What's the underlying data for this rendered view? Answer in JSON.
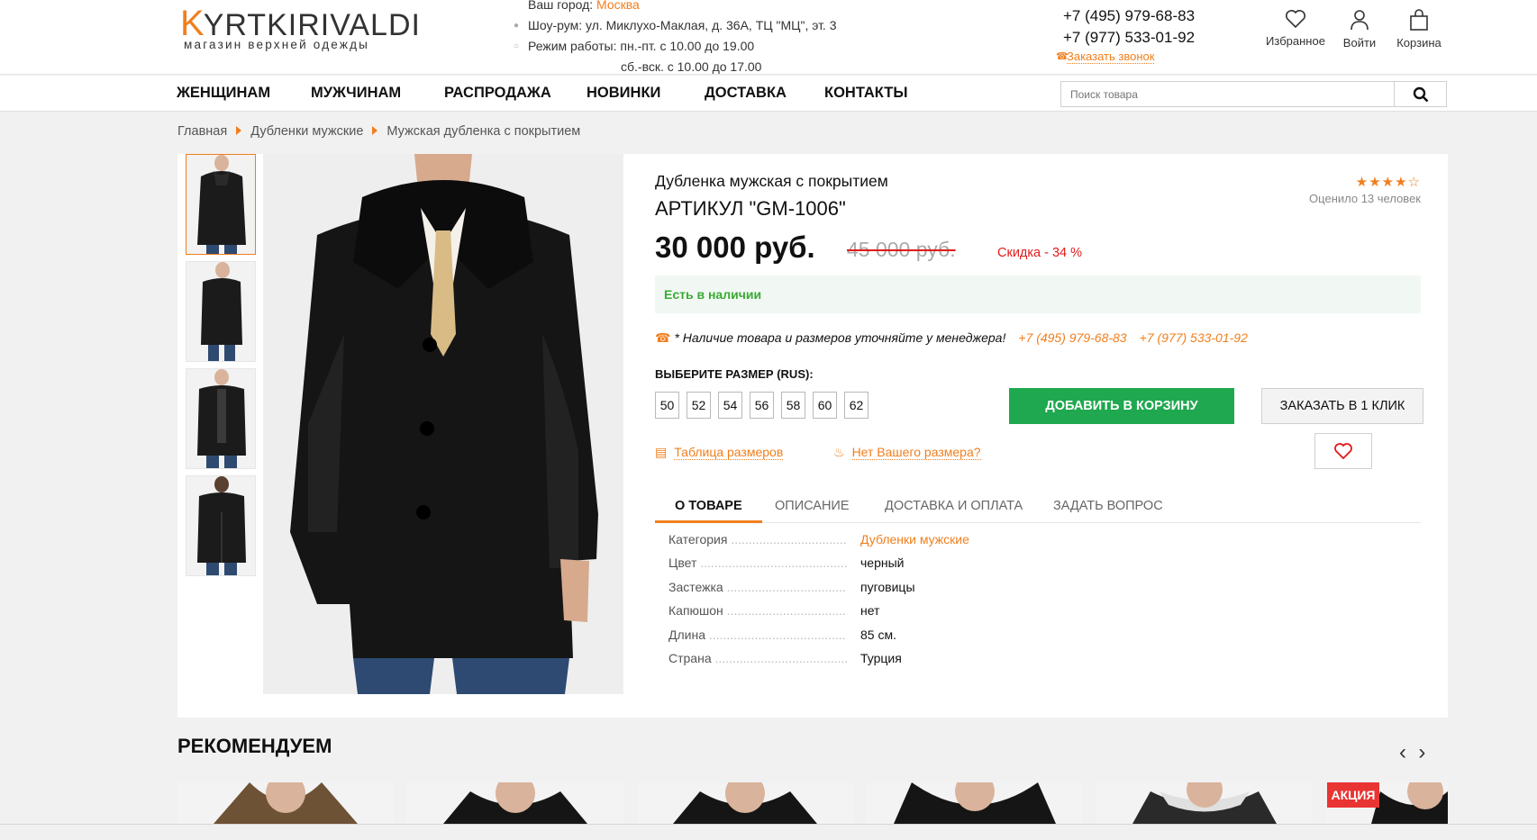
{
  "logo": {
    "main_a": "KYRTKI",
    "main_b": "RIVALDI",
    "sub": "магазин верхней одежды"
  },
  "header": {
    "city_label": "Ваш город:",
    "city": "Москва",
    "showroom": "Шоу-рум: ул. Миклухо-Маклая, д. 36А, ТЦ \"МЦ\", эт. 3",
    "hours_1": "Режим работы: пн.-пт.  с 10.00 до 19.00",
    "hours_2": "сб.-вск. с 10.00 до 17.00",
    "phone_1": "+7 (495) 979-68-83",
    "phone_2": "+7 (977) 533-01-92",
    "callback": "Заказать звонок",
    "favorites": "Избранное",
    "login": "Войти",
    "cart": "Корзина"
  },
  "nav": {
    "items": [
      "ЖЕНЩИНАМ",
      "МУЖЧИНАМ",
      "РАСПРОДАЖА",
      "НОВИНКИ",
      "ДОСТАВКА",
      "КОНТАКТЫ"
    ],
    "search_placeholder": "Поиск товара"
  },
  "breadcrumb": [
    "Главная",
    "Дубленки мужские",
    "Мужская дубленка с покрытием"
  ],
  "product": {
    "subtitle": "Дубленка мужская с покрытием",
    "title": "АРТИКУЛ \"GM-1006\"",
    "price": "30 000 руб.",
    "old_price": "45 000 руб.",
    "discount": "Скидка - 34 %",
    "rating_stars": 4,
    "rating_text": "Оценило 13 человек",
    "stock": "Есть в наличии",
    "note": "* Наличие товара и размеров уточняйте у менеджера!",
    "note_phone_1": "+7 (495) 979-68-83",
    "note_phone_2": "+7 (977) 533-01-92",
    "size_label": "ВЫБЕРИТЕ РАЗМЕР (RUS):",
    "sizes": [
      "50",
      "52",
      "54",
      "56",
      "58",
      "60",
      "62"
    ],
    "add_to_cart": "ДОБАВИТЬ В КОРЗИНУ",
    "one_click": "ЗАКАЗАТЬ В 1 КЛИК",
    "size_table": "Таблица размеров",
    "no_size": "Нет Вашего размера?"
  },
  "tabs": [
    "О ТОВАРЕ",
    "ОПИСАНИЕ",
    "ДОСТАВКА И ОПЛАТА",
    "ЗАДАТЬ ВОПРОС"
  ],
  "props": [
    {
      "k": "Категория",
      "v": "Дубленки мужские"
    },
    {
      "k": "Цвет",
      "v": "черный"
    },
    {
      "k": "Застежка",
      "v": "пуговицы"
    },
    {
      "k": "Капюшон",
      "v": "нет"
    },
    {
      "k": "Длина",
      "v": "85 см."
    },
    {
      "k": "Страна",
      "v": "Турция"
    }
  ],
  "recommend": {
    "title": "РЕКОМЕНДУЕМ",
    "badge": "АКЦИЯ"
  },
  "colors": {
    "accent": "#f07f1e",
    "green": "#1fa84f",
    "red": "#e21a1a"
  }
}
